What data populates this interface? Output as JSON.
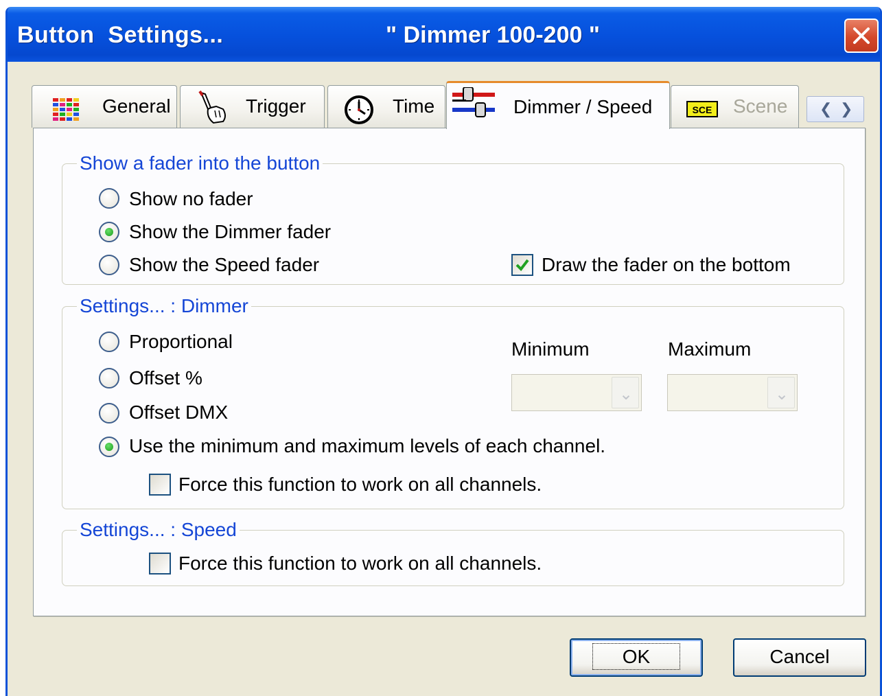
{
  "window": {
    "title": "Button  Settings...",
    "subtitle": "\" Dimmer 100-200 \""
  },
  "tabs": [
    {
      "label": "General",
      "icon": "color-grid-icon",
      "active": false
    },
    {
      "label": "Trigger",
      "icon": "pointing-hand-icon",
      "active": false
    },
    {
      "label": "Time",
      "icon": "clock-icon",
      "active": false
    },
    {
      "label": "Dimmer / Speed",
      "icon": "fader-sliders-icon",
      "active": true
    },
    {
      "label": "Scene",
      "icon": "sce-badge-icon",
      "icon_text": "SCE",
      "active": false,
      "disabled": true
    }
  ],
  "fader_group": {
    "legend": "Show a fader into the button",
    "options": [
      "Show no fader",
      "Show the Dimmer fader",
      "Show the Speed fader"
    ],
    "selected": "Show the Dimmer fader",
    "draw_bottom_label": "Draw the fader on the bottom",
    "draw_bottom_checked": true
  },
  "dimmer_group": {
    "legend": "Settings... : Dimmer",
    "options": [
      "Proportional",
      "Offset %",
      "Offset DMX",
      "Use the minimum and maximum levels of each channel."
    ],
    "selected": "Use the minimum and maximum levels of each channel.",
    "minimum_label": "Minimum",
    "maximum_label": "Maximum",
    "minimum_value": "",
    "maximum_value": "",
    "force_label": "Force this function to work on all channels.",
    "force_checked": false
  },
  "speed_group": {
    "legend": "Settings... : Speed",
    "force_label": "Force this function to work on all channels.",
    "force_checked": false
  },
  "buttons": {
    "ok": "OK",
    "cancel": "Cancel"
  },
  "colors": {
    "titlebar": "#0650dc",
    "dialog_bg": "#ece9d8",
    "legend_text": "#1546d6",
    "active_tab_accent": "#e68b2c"
  }
}
